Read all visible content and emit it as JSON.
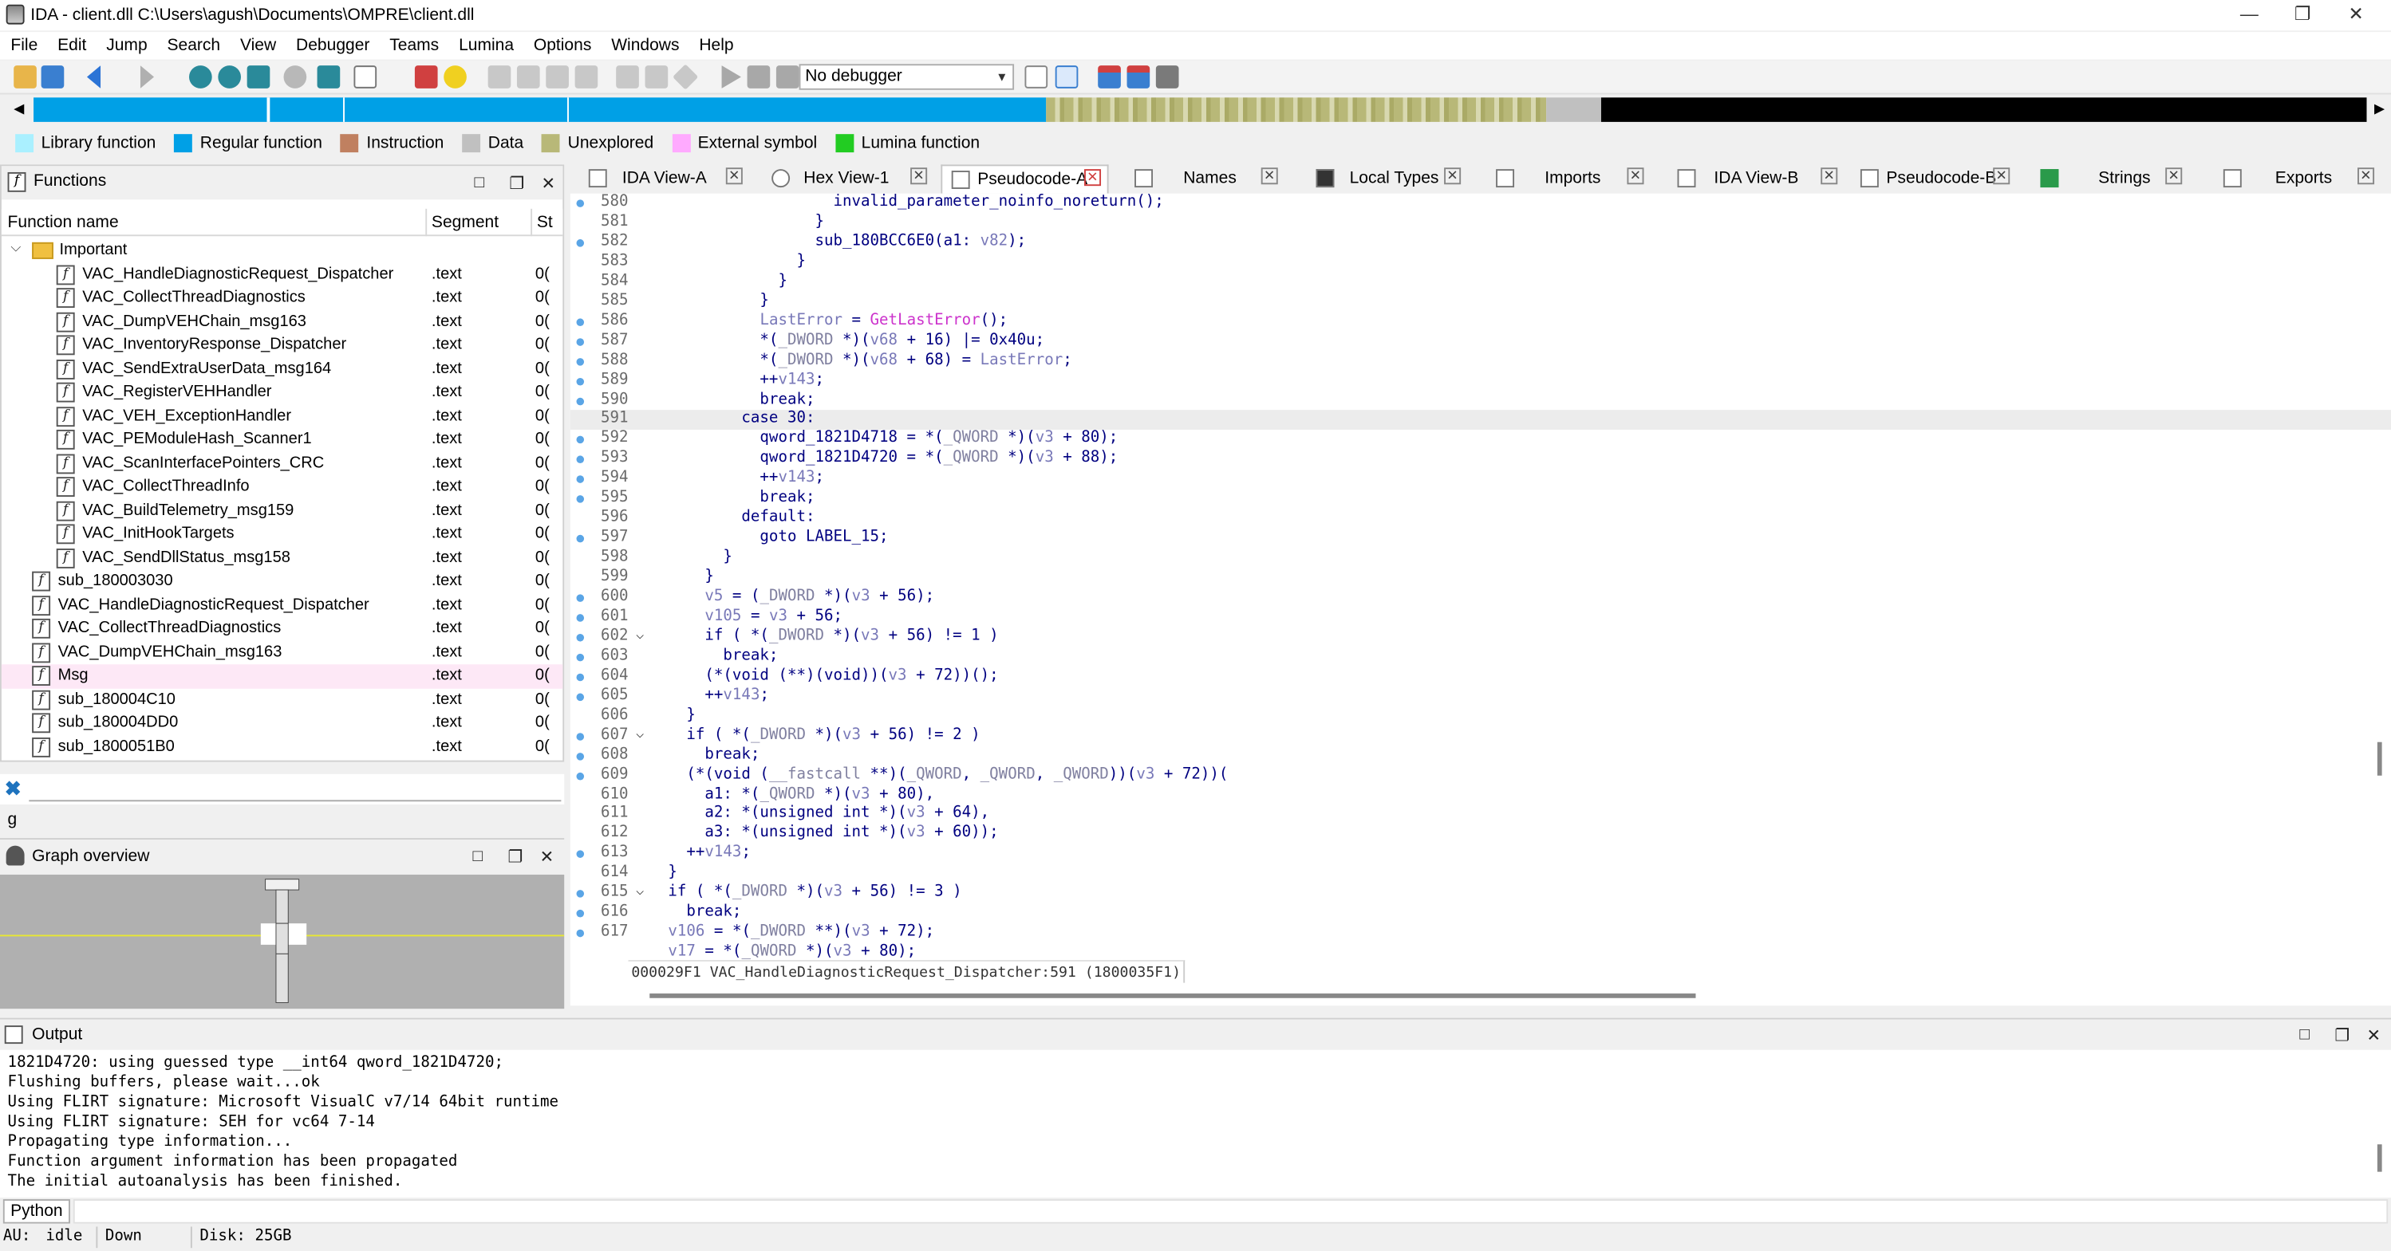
{
  "window": {
    "title": "IDA - client.dll C:\\Users\\agush\\Documents\\OMPRE\\client.dll",
    "min": "—",
    "max": "❐",
    "close": "✕"
  },
  "menu": [
    "File",
    "Edit",
    "Jump",
    "Search",
    "View",
    "Debugger",
    "Teams",
    "Lumina",
    "Options",
    "Windows",
    "Help"
  ],
  "toolbar": {
    "debugger": "No debugger"
  },
  "legend": [
    {
      "label": "Library function",
      "color": "#aaf0ff"
    },
    {
      "label": "Regular function",
      "color": "#00a0e6"
    },
    {
      "label": "Instruction",
      "color": "#c08060"
    },
    {
      "label": "Data",
      "color": "#c0c0c0"
    },
    {
      "label": "Unexplored",
      "color": "#b8b878"
    },
    {
      "label": "External symbol",
      "color": "#ffaaff"
    },
    {
      "label": "Lumina function",
      "color": "#22cc22"
    }
  ],
  "functions": {
    "title": "Functions",
    "headers": {
      "name": "Function name",
      "segment": "Segment",
      "start": "St"
    },
    "folder": "Important",
    "rows": [
      {
        "name": "VAC_HandleDiagnosticRequest_Dispatcher",
        "seg": ".text",
        "st": "0(",
        "indent": 1
      },
      {
        "name": "VAC_CollectThreadDiagnostics",
        "seg": ".text",
        "st": "0(",
        "indent": 1
      },
      {
        "name": "VAC_DumpVEHChain_msg163",
        "seg": ".text",
        "st": "0(",
        "indent": 1
      },
      {
        "name": "VAC_InventoryResponse_Dispatcher",
        "seg": ".text",
        "st": "0(",
        "indent": 1
      },
      {
        "name": "VAC_SendExtraUserData_msg164",
        "seg": ".text",
        "st": "0(",
        "indent": 1
      },
      {
        "name": "VAC_RegisterVEHHandler",
        "seg": ".text",
        "st": "0(",
        "indent": 1
      },
      {
        "name": "VAC_VEH_ExceptionHandler",
        "seg": ".text",
        "st": "0(",
        "indent": 1
      },
      {
        "name": "VAC_PEModuleHash_Scanner1",
        "seg": ".text",
        "st": "0(",
        "indent": 1
      },
      {
        "name": "VAC_ScanInterfacePointers_CRC",
        "seg": ".text",
        "st": "0(",
        "indent": 1
      },
      {
        "name": "VAC_CollectThreadInfo",
        "seg": ".text",
        "st": "0(",
        "indent": 1
      },
      {
        "name": "VAC_BuildTelemetry_msg159",
        "seg": ".text",
        "st": "0(",
        "indent": 1
      },
      {
        "name": "VAC_InitHookTargets",
        "seg": ".text",
        "st": "0(",
        "indent": 1
      },
      {
        "name": "VAC_SendDllStatus_msg158",
        "seg": ".text",
        "st": "0(",
        "indent": 1
      },
      {
        "name": "sub_180003030",
        "seg": ".text",
        "st": "0(",
        "indent": 0
      },
      {
        "name": "VAC_HandleDiagnosticRequest_Dispatcher",
        "seg": ".text",
        "st": "0(",
        "indent": 0
      },
      {
        "name": "VAC_CollectThreadDiagnostics",
        "seg": ".text",
        "st": "0(",
        "indent": 0
      },
      {
        "name": "VAC_DumpVEHChain_msg163",
        "seg": ".text",
        "st": "0(",
        "indent": 0
      },
      {
        "name": "Msg",
        "seg": ".text",
        "st": "0(",
        "indent": 0,
        "pink": true
      },
      {
        "name": "sub_180004C10",
        "seg": ".text",
        "st": "0(",
        "indent": 0
      },
      {
        "name": "sub_180004DD0",
        "seg": ".text",
        "st": "0(",
        "indent": 0
      },
      {
        "name": "sub_1800051B0",
        "seg": ".text",
        "st": "0(",
        "indent": 0
      }
    ],
    "filter_char": "g"
  },
  "graph": {
    "title": "Graph overview"
  },
  "tabs": [
    {
      "label": "IDA View-A",
      "active": false
    },
    {
      "label": "Hex View-1",
      "active": false
    },
    {
      "label": "Pseudocode-A",
      "active": true
    },
    {
      "label": "Names",
      "active": false
    },
    {
      "label": "Local Types",
      "active": false
    },
    {
      "label": "Imports",
      "active": false
    },
    {
      "label": "IDA View-B",
      "active": false
    },
    {
      "label": "Pseudocode-B",
      "active": false
    },
    {
      "label": "Strings",
      "active": false
    },
    {
      "label": "Exports",
      "active": false
    }
  ],
  "code": [
    {
      "n": "580",
      "dot": true,
      "t": "                      invalid_parameter_noinfo_noreturn();"
    },
    {
      "n": "581",
      "dot": false,
      "t": "                    }"
    },
    {
      "n": "582",
      "dot": true,
      "t": "                    sub_180BCC6E0(a1: v82);"
    },
    {
      "n": "583",
      "dot": false,
      "t": "                  }"
    },
    {
      "n": "584",
      "dot": false,
      "t": "                }"
    },
    {
      "n": "585",
      "dot": false,
      "t": "              }"
    },
    {
      "n": "586",
      "dot": true,
      "t": "              LastError = GetLastError();"
    },
    {
      "n": "587",
      "dot": true,
      "t": "              *(_DWORD *)(v68 + 16) |= 0x40u;"
    },
    {
      "n": "588",
      "dot": true,
      "t": "              *(_DWORD *)(v68 + 68) = LastError;"
    },
    {
      "n": "589",
      "dot": true,
      "t": "              ++v143;"
    },
    {
      "n": "590",
      "dot": true,
      "t": "              break;"
    },
    {
      "n": "591",
      "dot": false,
      "t": "            case 30:",
      "hl": true
    },
    {
      "n": "592",
      "dot": true,
      "t": "              qword_1821D4718 = *(_QWORD *)(v3 + 80);"
    },
    {
      "n": "593",
      "dot": true,
      "t": "              qword_1821D4720 = *(_QWORD *)(v3 + 88);"
    },
    {
      "n": "594",
      "dot": true,
      "t": "              ++v143;"
    },
    {
      "n": "595",
      "dot": true,
      "t": "              break;"
    },
    {
      "n": "596",
      "dot": false,
      "t": "            default:"
    },
    {
      "n": "597",
      "dot": true,
      "t": "              goto LABEL_15;"
    },
    {
      "n": "598",
      "dot": false,
      "t": "          }"
    },
    {
      "n": "599",
      "dot": false,
      "t": "        }"
    },
    {
      "n": "600",
      "dot": true,
      "t": "        v5 = (_DWORD *)(v3 + 56);"
    },
    {
      "n": "601",
      "dot": true,
      "t": "        v105 = v3 + 56;"
    },
    {
      "n": "602",
      "dot": true,
      "t": "        if ( *(_DWORD *)(v3 + 56) != 1 )",
      "fold": true
    },
    {
      "n": "603",
      "dot": true,
      "t": "          break;"
    },
    {
      "n": "604",
      "dot": true,
      "t": "        (*(void (**)(void))(v3 + 72))();"
    },
    {
      "n": "605",
      "dot": true,
      "t": "        ++v143;"
    },
    {
      "n": "606",
      "dot": false,
      "t": "      }"
    },
    {
      "n": "607",
      "dot": true,
      "t": "      if ( *(_DWORD *)(v3 + 56) != 2 )",
      "fold": true
    },
    {
      "n": "608",
      "dot": true,
      "t": "        break;"
    },
    {
      "n": "609",
      "dot": true,
      "t": "      (*(void (__fastcall **)(_QWORD, _QWORD, _QWORD))(v3 + 72))("
    },
    {
      "n": "610",
      "dot": false,
      "t": "        a1: *(_QWORD *)(v3 + 80),"
    },
    {
      "n": "611",
      "dot": false,
      "t": "        a2: *(unsigned int *)(v3 + 64),"
    },
    {
      "n": "612",
      "dot": false,
      "t": "        a3: *(unsigned int *)(v3 + 60));"
    },
    {
      "n": "613",
      "dot": true,
      "t": "      ++v143;"
    },
    {
      "n": "614",
      "dot": false,
      "t": "    }"
    },
    {
      "n": "615",
      "dot": true,
      "t": "    if ( *(_DWORD *)(v3 + 56) != 3 )",
      "fold": true
    },
    {
      "n": "616",
      "dot": true,
      "t": "      break;"
    },
    {
      "n": "617",
      "dot": true,
      "t": "    v106 = *(_DWORD **)(v3 + 72);"
    },
    {
      "n": "",
      "dot": false,
      "t": "    v17 = *(_QWORD *)(v3 + 80);"
    }
  ],
  "code_status": "000029F1 VAC_HandleDiagnosticRequest_Dispatcher:591 (1800035F1)",
  "output": {
    "title": "Output",
    "lines": [
      "1821D4720: using guessed type __int64 qword_1821D4720;",
      "Flushing buffers, please wait...ok",
      "Using FLIRT signature: Microsoft VisualC v7/14 64bit runtime",
      "Using FLIRT signature: SEH for vc64 7-14",
      "Propagating type information...",
      "Function argument information has been propagated",
      "The initial autoanalysis has been finished."
    ]
  },
  "python_label": "Python",
  "status": {
    "au": "AU:",
    "state": "idle",
    "dir": "Down",
    "disk": "Disk: 25GB"
  },
  "panel_ctrls": {
    "maximize": "□",
    "float": "❐",
    "close": "✕"
  }
}
